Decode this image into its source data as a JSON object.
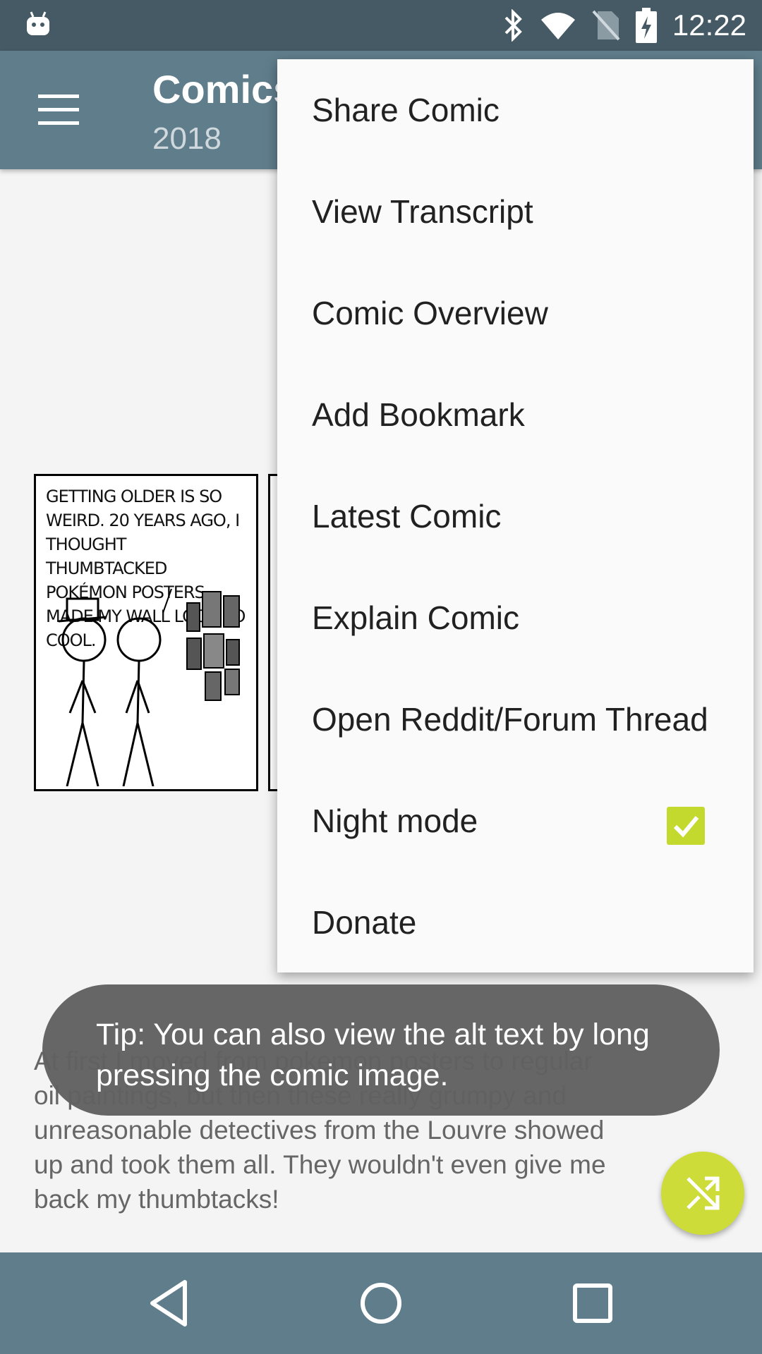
{
  "status_bar": {
    "time": "12:22",
    "icons": [
      "android-icon",
      "bluetooth-icon",
      "wifi-icon",
      "no-sim-icon",
      "battery-charging-icon"
    ]
  },
  "app_bar": {
    "title": "Comics",
    "subtitle": "2018",
    "menu_icon": "hamburger-icon"
  },
  "comic": {
    "panel_text": "GETTING OLDER IS SO WEIRD. 20 YEARS AGO, I THOUGHT THUMBTACKED POKÉMON POSTERS MADE MY WALL LOOK SO COOL."
  },
  "alt_text": "At first I moved from pokemon posters to regular oil paintings, but then these really grumpy and unreasonable detectives from the Louvre showed up and took them all. They wouldn't even give me back my thumbtacks!",
  "overflow_menu": {
    "items": [
      {
        "label": "Share Comic"
      },
      {
        "label": "View Transcript"
      },
      {
        "label": "Comic Overview"
      },
      {
        "label": "Add Bookmark"
      },
      {
        "label": "Latest Comic"
      },
      {
        "label": "Explain Comic"
      },
      {
        "label": "Open Reddit/Forum Thread"
      },
      {
        "label": "Night mode",
        "checked": true
      },
      {
        "label": "Donate"
      }
    ]
  },
  "toast": {
    "message": "Tip: You can also view the alt text by long pressing the comic image."
  },
  "fab": {
    "icon": "shuffle-icon"
  },
  "nav_bar": {
    "icons": [
      "back-icon",
      "home-icon",
      "recents-icon"
    ]
  },
  "colors": {
    "status_bar": "#455a64",
    "app_bar": "#607d8b",
    "accent": "#cddc39"
  }
}
